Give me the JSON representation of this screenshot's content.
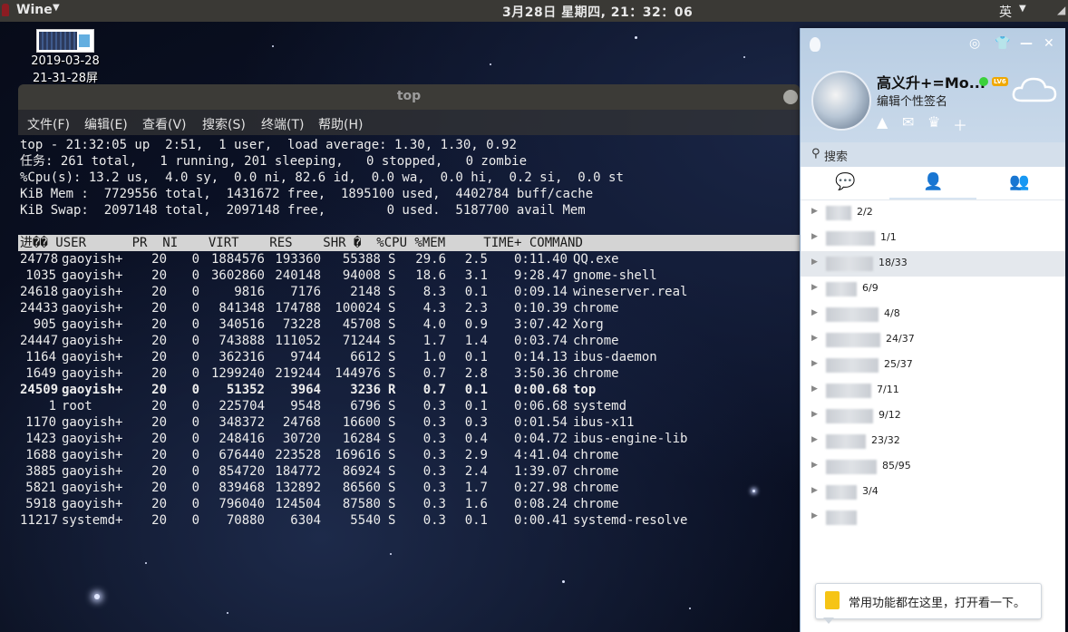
{
  "topbar": {
    "app_name": "Wine",
    "clock": "3月28日 星期四, 21：32：06",
    "input_method": "英"
  },
  "desktop_icon": {
    "label_line1": "2019-03-28",
    "label_line2": "21-31-28屏"
  },
  "terminal": {
    "title": "top",
    "menu": [
      "文件(F)",
      "编辑(E)",
      "查看(V)",
      "搜索(S)",
      "终端(T)",
      "帮助(H)"
    ],
    "summary": [
      "top - 21:32:05 up  2:51,  1 user,  load average: 1.30, 1.30, 0.92",
      "任务: 261 total,   1 running, 201 sleeping,   0 stopped,   0 zombie",
      "%Cpu(s): 13.2 us,  4.0 sy,  0.0 ni, 82.6 id,  0.0 wa,  0.0 hi,  0.2 si,  0.0 st",
      "KiB Mem :  7729556 total,  1431672 free,  1895100 used,  4402784 buff/cache",
      "KiB Swap:  2097148 total,  2097148 free,        0 used.  5187700 avail Mem"
    ],
    "header": "进�� USER      PR  NI    VIRT    RES    SHR �  %CPU %MEM     TIME+ COMMAND",
    "processes": [
      {
        "pid": "24778",
        "user": "gaoyish+",
        "pr": "20",
        "ni": "0",
        "virt": "1884576",
        "res": "193360",
        "shr": "55388",
        "s": "S",
        "cpu": "29.6",
        "mem": "2.5",
        "time": "0:11.40",
        "cmd": "QQ.exe"
      },
      {
        "pid": "1035",
        "user": "gaoyish+",
        "pr": "20",
        "ni": "0",
        "virt": "3602860",
        "res": "240148",
        "shr": "94008",
        "s": "S",
        "cpu": "18.6",
        "mem": "3.1",
        "time": "9:28.47",
        "cmd": "gnome-shell"
      },
      {
        "pid": "24618",
        "user": "gaoyish+",
        "pr": "20",
        "ni": "0",
        "virt": "9816",
        "res": "7176",
        "shr": "2148",
        "s": "S",
        "cpu": "8.3",
        "mem": "0.1",
        "time": "0:09.14",
        "cmd": "wineserver.real"
      },
      {
        "pid": "24433",
        "user": "gaoyish+",
        "pr": "20",
        "ni": "0",
        "virt": "841348",
        "res": "174788",
        "shr": "100024",
        "s": "S",
        "cpu": "4.3",
        "mem": "2.3",
        "time": "0:10.39",
        "cmd": "chrome"
      },
      {
        "pid": "905",
        "user": "gaoyish+",
        "pr": "20",
        "ni": "0",
        "virt": "340516",
        "res": "73228",
        "shr": "45708",
        "s": "S",
        "cpu": "4.0",
        "mem": "0.9",
        "time": "3:07.42",
        "cmd": "Xorg"
      },
      {
        "pid": "24447",
        "user": "gaoyish+",
        "pr": "20",
        "ni": "0",
        "virt": "743888",
        "res": "111052",
        "shr": "71244",
        "s": "S",
        "cpu": "1.7",
        "mem": "1.4",
        "time": "0:03.74",
        "cmd": "chrome"
      },
      {
        "pid": "1164",
        "user": "gaoyish+",
        "pr": "20",
        "ni": "0",
        "virt": "362316",
        "res": "9744",
        "shr": "6612",
        "s": "S",
        "cpu": "1.0",
        "mem": "0.1",
        "time": "0:14.13",
        "cmd": "ibus-daemon"
      },
      {
        "pid": "1649",
        "user": "gaoyish+",
        "pr": "20",
        "ni": "0",
        "virt": "1299240",
        "res": "219244",
        "shr": "144976",
        "s": "S",
        "cpu": "0.7",
        "mem": "2.8",
        "time": "3:50.36",
        "cmd": "chrome"
      },
      {
        "pid": "24509",
        "user": "gaoyish+",
        "pr": "20",
        "ni": "0",
        "virt": "51352",
        "res": "3964",
        "shr": "3236",
        "s": "R",
        "cpu": "0.7",
        "mem": "0.1",
        "time": "0:00.68",
        "cmd": "top",
        "bold": true
      },
      {
        "pid": "1",
        "user": "root",
        "pr": "20",
        "ni": "0",
        "virt": "225704",
        "res": "9548",
        "shr": "6796",
        "s": "S",
        "cpu": "0.3",
        "mem": "0.1",
        "time": "0:06.68",
        "cmd": "systemd"
      },
      {
        "pid": "1170",
        "user": "gaoyish+",
        "pr": "20",
        "ni": "0",
        "virt": "348372",
        "res": "24768",
        "shr": "16600",
        "s": "S",
        "cpu": "0.3",
        "mem": "0.3",
        "time": "0:01.54",
        "cmd": "ibus-x11"
      },
      {
        "pid": "1423",
        "user": "gaoyish+",
        "pr": "20",
        "ni": "0",
        "virt": "248416",
        "res": "30720",
        "shr": "16284",
        "s": "S",
        "cpu": "0.3",
        "mem": "0.4",
        "time": "0:04.72",
        "cmd": "ibus-engine-lib"
      },
      {
        "pid": "1688",
        "user": "gaoyish+",
        "pr": "20",
        "ni": "0",
        "virt": "676440",
        "res": "223528",
        "shr": "169616",
        "s": "S",
        "cpu": "0.3",
        "mem": "2.9",
        "time": "4:41.04",
        "cmd": "chrome"
      },
      {
        "pid": "3885",
        "user": "gaoyish+",
        "pr": "20",
        "ni": "0",
        "virt": "854720",
        "res": "184772",
        "shr": "86924",
        "s": "S",
        "cpu": "0.3",
        "mem": "2.4",
        "time": "1:39.07",
        "cmd": "chrome"
      },
      {
        "pid": "5821",
        "user": "gaoyish+",
        "pr": "20",
        "ni": "0",
        "virt": "839468",
        "res": "132892",
        "shr": "86560",
        "s": "S",
        "cpu": "0.3",
        "mem": "1.7",
        "time": "0:27.98",
        "cmd": "chrome"
      },
      {
        "pid": "5918",
        "user": "gaoyish+",
        "pr": "20",
        "ni": "0",
        "virt": "796040",
        "res": "124504",
        "shr": "87580",
        "s": "S",
        "cpu": "0.3",
        "mem": "1.6",
        "time": "0:08.24",
        "cmd": "chrome"
      },
      {
        "pid": "11217",
        "user": "systemd+",
        "pr": "20",
        "ni": "0",
        "virt": "70880",
        "res": "6304",
        "shr": "5540",
        "s": "S",
        "cpu": "0.3",
        "mem": "0.1",
        "time": "0:00.41",
        "cmd": "systemd-resolve"
      }
    ]
  },
  "qq": {
    "name": "高义升+=Mo...",
    "level": "LV6",
    "signature": "编辑个性签名",
    "search_placeholder": "搜索",
    "groups": [
      "2/2",
      "1/1",
      "18/33",
      "6/9",
      "4/8",
      "24/37",
      "25/37",
      "7/11",
      "9/12",
      "23/32",
      "85/95",
      "3/4",
      ""
    ],
    "tip": "常用功能都在这里，打开看一下。",
    "colors": {
      "header": "#c0d3e8",
      "online": "#3bd13b",
      "accent": "#2f7fd6"
    }
  }
}
